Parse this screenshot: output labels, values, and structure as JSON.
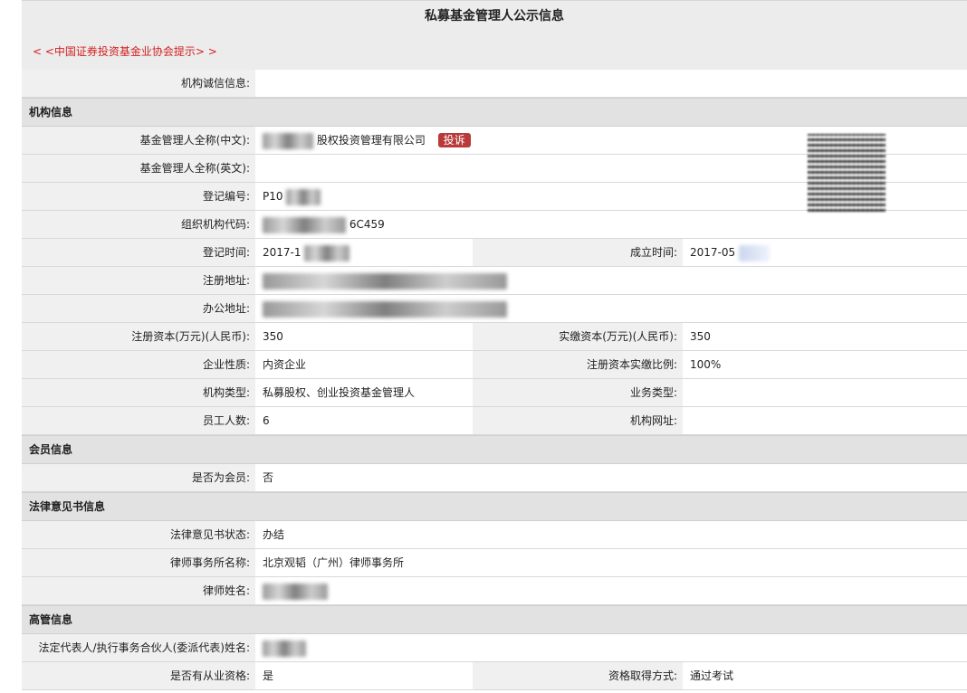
{
  "header": {
    "title": "私募基金管理人公示信息",
    "tip": "< <中国证券投资基金业协会提示> >"
  },
  "rows": {
    "credit_label": "机构诚信信息:",
    "credit_value": ""
  },
  "sections": {
    "org_info": "机构信息",
    "member_info": "会员信息",
    "legal_info": "法律意见书信息",
    "exec_info": "高管信息"
  },
  "org": {
    "cn_name_label": "基金管理人全称(中文):",
    "cn_name_value": "股权投资管理有限公司",
    "complain": "投诉",
    "en_name_label": "基金管理人全称(英文):",
    "en_name_value": "",
    "reg_no_label": "登记编号:",
    "reg_no_value": "P10",
    "org_code_label": "组织机构代码:",
    "org_code_value": "6C459",
    "reg_time_label": "登记时间:",
    "reg_time_value": "2017-1",
    "found_time_label": "成立时间:",
    "found_time_value": "2017-05",
    "reg_addr_label": "注册地址:",
    "reg_addr_value": "",
    "office_addr_label": "办公地址:",
    "office_addr_value": "",
    "reg_cap_label": "注册资本(万元)(人民币):",
    "reg_cap_value": "350",
    "paid_cap_label": "实缴资本(万元)(人民币):",
    "paid_cap_value": "350",
    "nature_label": "企业性质:",
    "nature_value": "内资企业",
    "ratio_label": "注册资本实缴比例:",
    "ratio_value": "100%",
    "type_label": "机构类型:",
    "type_value": "私募股权、创业投资基金管理人",
    "business_label": "业务类型:",
    "business_value": "",
    "staff_label": "员工人数:",
    "staff_value": "6",
    "site_label": "机构网址:",
    "site_value": ""
  },
  "member": {
    "is_member_label": "是否为会员:",
    "is_member_value": "否"
  },
  "legal": {
    "status_label": "法律意见书状态:",
    "status_value": "办结",
    "firm_label": "律师事务所名称:",
    "firm_value": "北京观韬（广州）律师事务所",
    "lawyer_label": "律师姓名:",
    "lawyer_value": ""
  },
  "exec": {
    "rep_label": "法定代表人/执行事务合伙人(委派代表)姓名:",
    "rep_value": "",
    "qualified_label": "是否有从业资格:",
    "qualified_value": "是",
    "method_label": "资格取得方式:",
    "method_value": "通过考试"
  },
  "icons": {
    "qr": "qr-code-icon"
  }
}
